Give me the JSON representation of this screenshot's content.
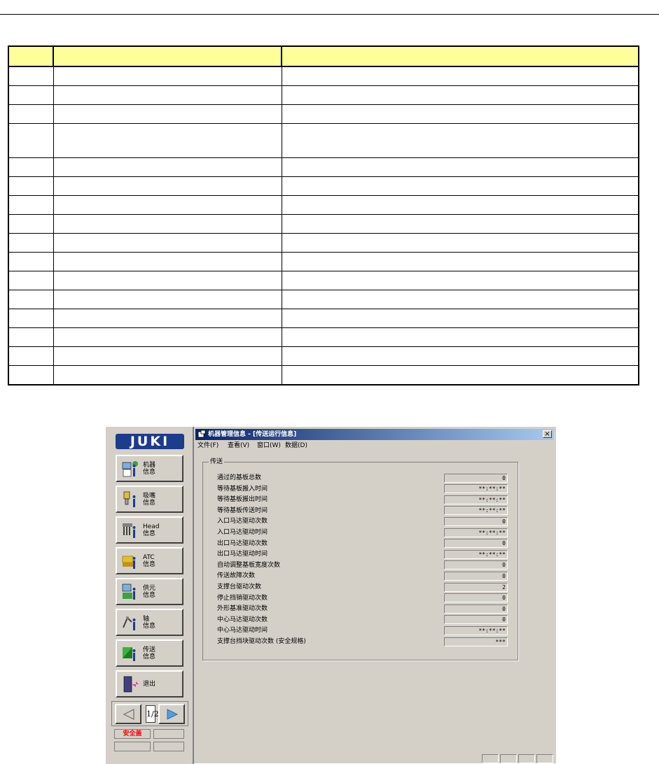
{
  "document": {
    "rows": 16,
    "header_color": "#ffff99"
  },
  "app": {
    "logo": "JUKI",
    "logo_color": "#1c3c8c",
    "sidebar_buttons": [
      {
        "label1": "机器",
        "label2": "信息",
        "icon": "machine-info-icon"
      },
      {
        "label1": "吸嘴",
        "label2": "信息",
        "icon": "nozzle-info-icon"
      },
      {
        "label1": "Head",
        "label2": "信息",
        "icon": "head-info-icon"
      },
      {
        "label1": "ATC",
        "label2": "信息",
        "icon": "atc-info-icon"
      },
      {
        "label1": "供元",
        "label2": "信息",
        "icon": "feeder-info-icon"
      },
      {
        "label1": "轴",
        "label2": "信息",
        "icon": "axis-info-icon"
      },
      {
        "label1": "传送",
        "label2": "信息",
        "icon": "conveyor-info-icon"
      },
      {
        "label1": "退出",
        "label2": "",
        "icon": "exit-icon"
      }
    ],
    "pager": {
      "indicator": "1/2"
    },
    "safety_label": "安全盖",
    "window_title": "机器管理信息 - [传送运行信息]",
    "close_label": "×",
    "menu": [
      "文件(F)",
      "查看(V)",
      "窗口(W)",
      "数据(D)"
    ],
    "group_title": "传送",
    "rows": [
      {
        "label": "通过的基板总数",
        "value": "0"
      },
      {
        "label": "等待基板搬入时间",
        "value": "**:**:**"
      },
      {
        "label": "等待基板搬出时间",
        "value": "**:**:**"
      },
      {
        "label": "等待基板传送时间",
        "value": "**:**:**"
      },
      {
        "label": "入口马达驱动次数",
        "value": "0"
      },
      {
        "label": "入口马达驱动时间",
        "value": "**:**:**"
      },
      {
        "label": "出口马达驱动次数",
        "value": "0"
      },
      {
        "label": "出口马达驱动时间",
        "value": "**:**:**"
      },
      {
        "label": "自动调整基板宽度次数",
        "value": "0"
      },
      {
        "label": "传送故障次数",
        "value": "0"
      },
      {
        "label": "支撑台驱动次数",
        "value": "2"
      },
      {
        "label": "停止挡销驱动次数",
        "value": "0"
      },
      {
        "label": "外形基准驱动次数",
        "value": "0"
      },
      {
        "label": "中心马达驱动次数",
        "value": "0"
      },
      {
        "label": "中心马达驱动时间",
        "value": "**:**:**"
      },
      {
        "label": "支撑台挡块驱动次数 (安全规格)",
        "value": "***"
      }
    ]
  }
}
